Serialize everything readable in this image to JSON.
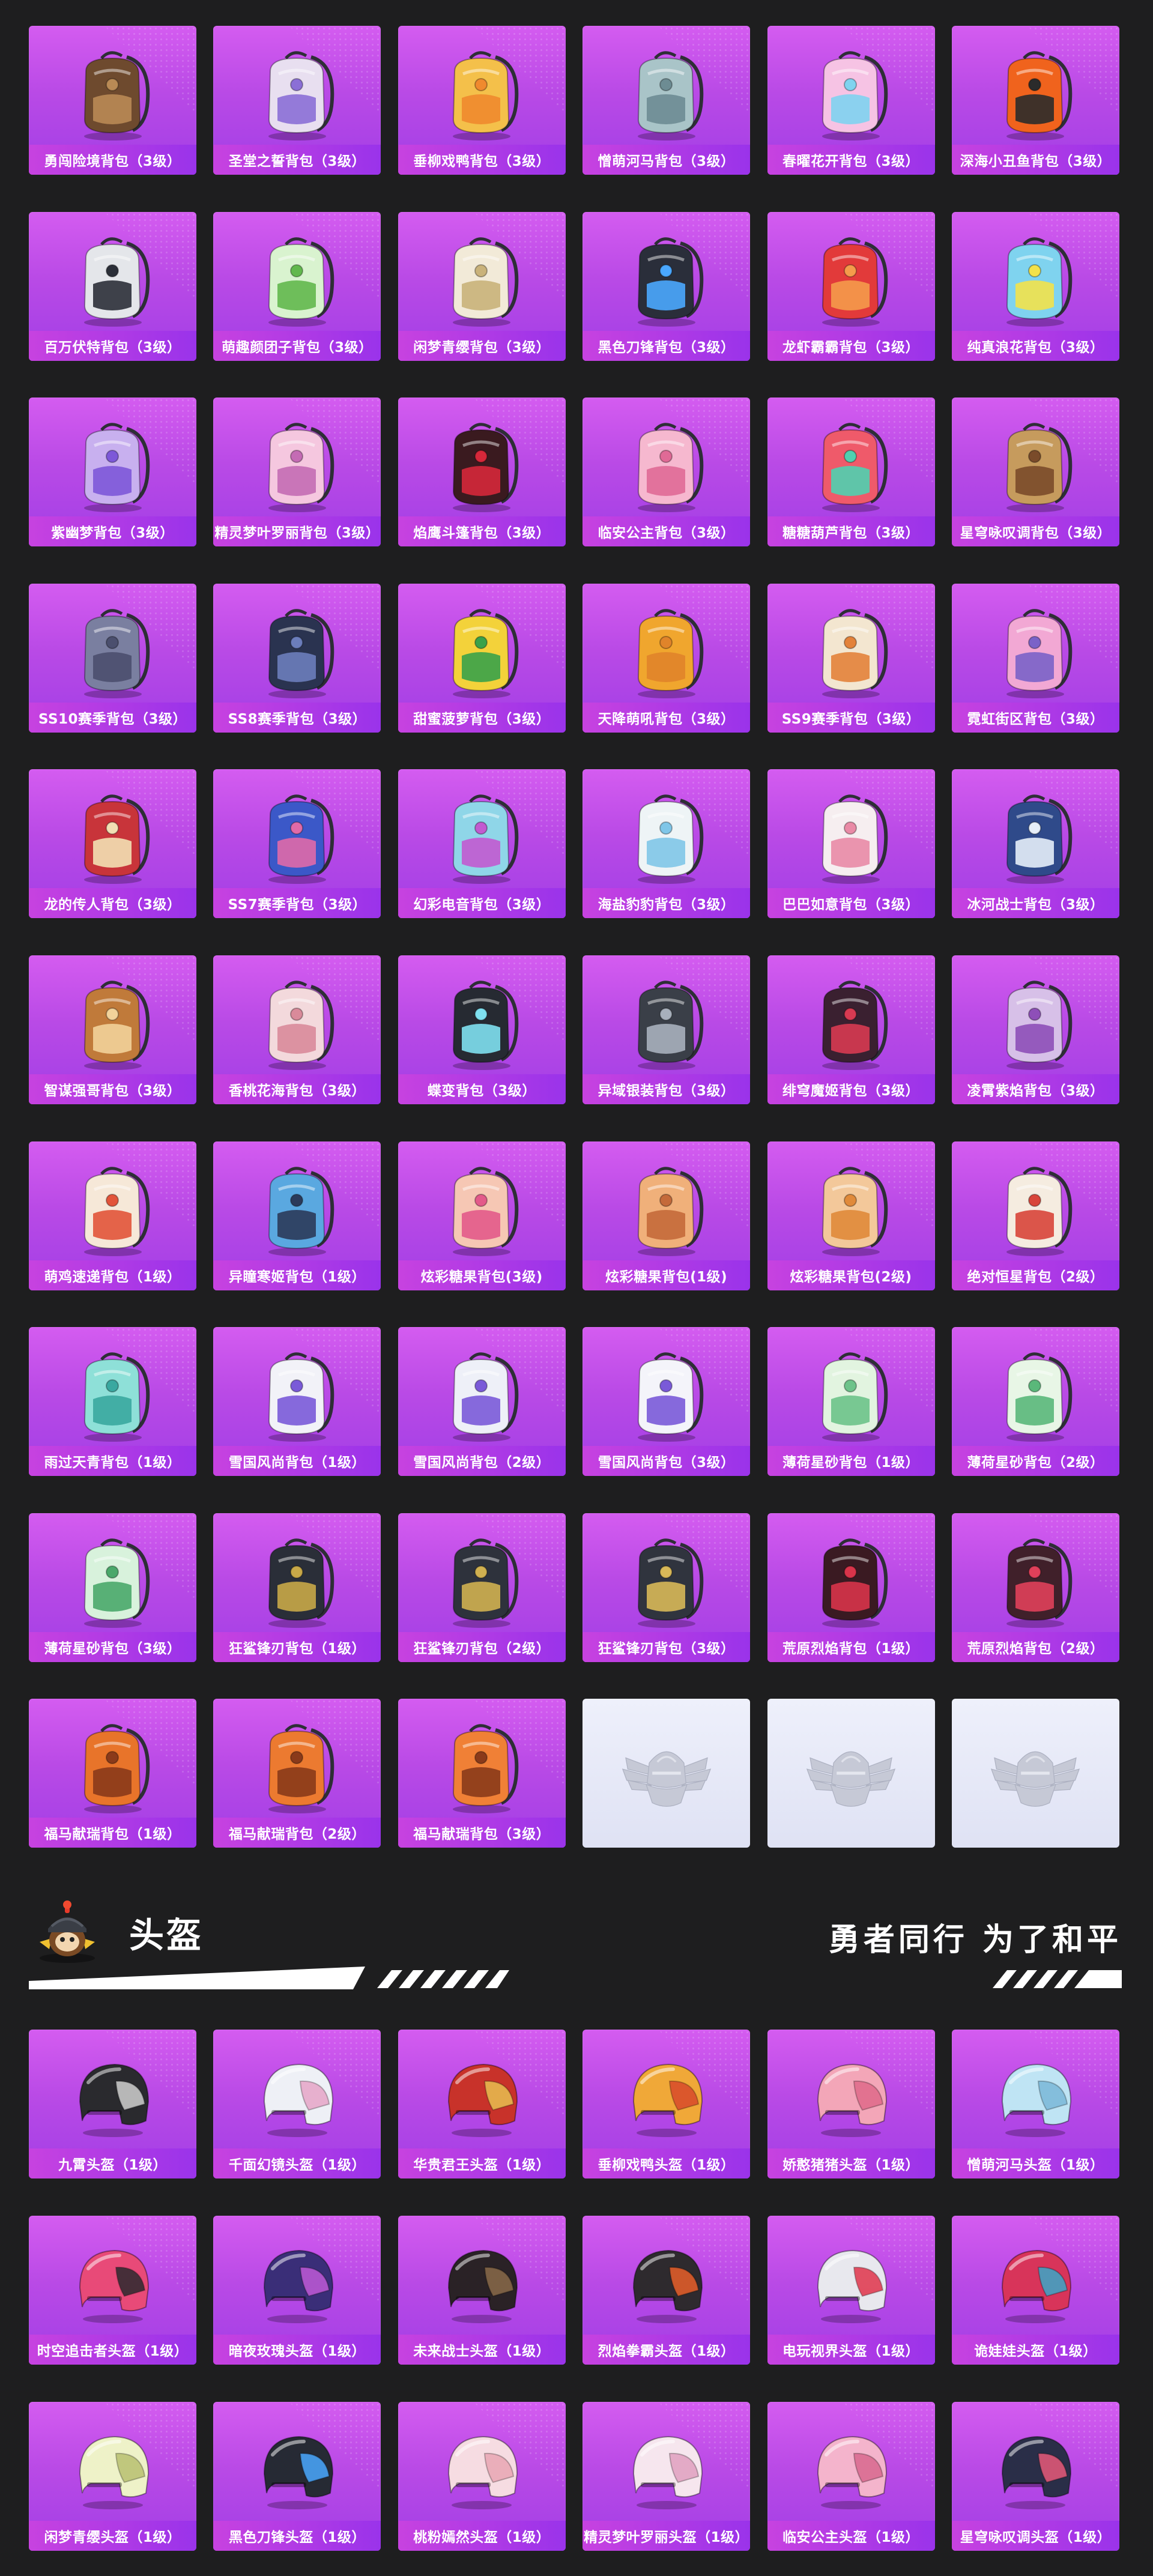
{
  "backpacks": [
    {
      "label": "勇闯险境背包（3级）",
      "icon": "brown-leather-backpack-icon",
      "color": "#6e4a2e",
      "accent": "#b98a55"
    },
    {
      "label": "圣堂之誓背包（3级）",
      "icon": "winged-white-backpack-icon",
      "color": "#e8dff0",
      "accent": "#8b6fd6"
    },
    {
      "label": "垂柳戏鸭背包（3级）",
      "icon": "yellow-duck-backpack-icon",
      "color": "#f4c04a",
      "accent": "#f08a2e"
    },
    {
      "label": "憎萌河马背包（3级）",
      "icon": "hippo-backpack-icon",
      "color": "#a9c4c8",
      "accent": "#6d8c93"
    },
    {
      "label": "春曜花开背包（3级）",
      "icon": "butterfly-backpack-icon",
      "color": "#f6c3e4",
      "accent": "#7fd3ef"
    },
    {
      "label": "深海小丑鱼背包（3级）",
      "icon": "clownfish-backpack-icon",
      "color": "#f0631d",
      "accent": "#2b2b2b"
    },
    {
      "label": "百万伏特背包（3级）",
      "icon": "robot-backpack-icon",
      "color": "#e4e6ea",
      "accent": "#2b2f38"
    },
    {
      "label": "萌趣颜团子背包（3级）",
      "icon": "green-sprout-backpack-icon",
      "color": "#d9f3cf",
      "accent": "#62b84d"
    },
    {
      "label": "闲梦青缨背包（3级）",
      "icon": "white-lantern-backpack-icon",
      "color": "#f2ead8",
      "accent": "#c9b27a"
    },
    {
      "label": "黑色刀锋背包（3级）",
      "icon": "black-tech-backpack-icon",
      "color": "#2a2e3a",
      "accent": "#4aa8ff"
    },
    {
      "label": "龙虾霸霸背包（3级）",
      "icon": "lobster-backpack-icon",
      "color": "#e23a3a",
      "accent": "#f59b4b"
    },
    {
      "label": "纯真浪花背包（3级）",
      "icon": "drink-cup-backpack-icon",
      "color": "#7fd3ef",
      "accent": "#f3e24a"
    },
    {
      "label": "紫幽梦背包（3级）",
      "icon": "purple-rabbit-backpack-icon",
      "color": "#c8b0ef",
      "accent": "#7d58d8"
    },
    {
      "label": "精灵梦叶罗丽背包（3级）",
      "icon": "pink-fairy-backpack-icon",
      "color": "#f5c7df",
      "accent": "#c46bb4"
    },
    {
      "label": "焰鹰斗篷背包（3级）",
      "icon": "red-black-backpack-icon",
      "color": "#3a1a1f",
      "accent": "#d6283a"
    },
    {
      "label": "临安公主背包（3级）",
      "icon": "pink-flower-backpack-icon",
      "color": "#f6b8cf",
      "accent": "#e06a96"
    },
    {
      "label": "糖糖葫芦背包（3级）",
      "icon": "candy-gourd-backpack-icon",
      "color": "#ef5a6a",
      "accent": "#4fd0b0"
    },
    {
      "label": "星穹咏叹调背包（3级）",
      "icon": "gold-chest-backpack-icon",
      "color": "#c69b5d",
      "accent": "#7a4b2a"
    },
    {
      "label": "SS10赛季背包（3级）",
      "icon": "grey-purple-backpack-icon",
      "color": "#7a7fa0",
      "accent": "#4b4f6e"
    },
    {
      "label": "SS8赛季背包（3级）",
      "icon": "navy-backpack-icon",
      "color": "#2a3350",
      "accent": "#6b7dbb"
    },
    {
      "label": "甜蜜菠萝背包（3级）",
      "icon": "pineapple-backpack-icon",
      "color": "#f3d23a",
      "accent": "#3aa24a"
    },
    {
      "label": "天降萌吼背包（3级）",
      "icon": "orange-gold-backpack-icon",
      "color": "#f0a62e",
      "accent": "#e0842a"
    },
    {
      "label": "SS9赛季背包（3级）",
      "icon": "orange-white-backpack-icon",
      "color": "#f3e6d0",
      "accent": "#e3823a"
    },
    {
      "label": "霓虹街区背包（3级）",
      "icon": "neon-pink-backpack-icon",
      "color": "#f2a8d4",
      "accent": "#7a62c8"
    },
    {
      "label": "龙的传人背包（3级）",
      "icon": "red-dragon-backpack-icon",
      "color": "#c8343a",
      "accent": "#f2e0b4"
    },
    {
      "label": "SS7赛季背包（3级）",
      "icon": "blue-galaxy-backpack-icon",
      "color": "#3b58c8",
      "accent": "#e06aa8"
    },
    {
      "label": "幻彩电音背包（3级）",
      "icon": "speaker-backpack-icon",
      "color": "#8fd6e8",
      "accent": "#c25ad0"
    },
    {
      "label": "海盐豹豹背包（3级）",
      "icon": "seal-backpack-icon",
      "color": "#eef4f6",
      "accent": "#7fc6e8"
    },
    {
      "label": "巴巴如意背包（3级）",
      "icon": "white-cat-backpack-icon",
      "color": "#f6eef0",
      "accent": "#e98aa6"
    },
    {
      "label": "冰河战士背包（3级）",
      "icon": "ice-blue-backpack-icon",
      "color": "#2f4a8a",
      "accent": "#e6eef8"
    },
    {
      "label": "智谋强哥背包（3级）",
      "icon": "monkey-backpack-icon",
      "color": "#c07a3a",
      "accent": "#f2d29a"
    },
    {
      "label": "香桃花海背包（3级）",
      "icon": "shell-backpack-icon",
      "color": "#f3d9dc",
      "accent": "#d98a9a"
    },
    {
      "label": "蝶变背包（3级）",
      "icon": "black-butterfly-backpack-icon",
      "color": "#262a32",
      "accent": "#7fe0f0"
    },
    {
      "label": "异域银装背包（3级）",
      "icon": "silver-armor-backpack-icon",
      "color": "#3a3f48",
      "accent": "#a8b0bc"
    },
    {
      "label": "绯穹魔姬背包（3级）",
      "icon": "bat-backpack-icon",
      "color": "#3a2030",
      "accent": "#d83a52"
    },
    {
      "label": "凌霄紫焰背包（3级）",
      "icon": "purple-flame-backpack-icon",
      "color": "#d7c0e8",
      "accent": "#8e4fb8"
    },
    {
      "label": "萌鸡速递背包（1级）",
      "icon": "chick-backpack-icon",
      "color": "#f6e8d8",
      "accent": "#e2543a"
    },
    {
      "label": "异瞳寒姬背包（1级）",
      "icon": "blue-cat-backpack-icon",
      "color": "#5aa8e0",
      "accent": "#2b3a5a"
    },
    {
      "label": "炫彩糖果背包(3级)",
      "icon": "donut-backpack-icon",
      "color": "#f6c7b4",
      "accent": "#e35a8a"
    },
    {
      "label": "炫彩糖果背包(1级)",
      "icon": "donut-backpack-icon",
      "color": "#f0b07a",
      "accent": "#c46a3a"
    },
    {
      "label": "炫彩糖果背包(2级)",
      "icon": "donut-backpack-icon",
      "color": "#f3c89a",
      "accent": "#e08a3a"
    },
    {
      "label": "绝对恒星背包（2级）",
      "icon": "noodle-box-backpack-icon",
      "color": "#f5ece0",
      "accent": "#d8453a"
    },
    {
      "label": "雨过天青背包（1级）",
      "icon": "teal-drop-backpack-icon",
      "color": "#8ee0d8",
      "accent": "#3aa8a0"
    },
    {
      "label": "雪国风尚背包（1级）",
      "icon": "snow-bunny-backpack-icon",
      "color": "#f2f2f8",
      "accent": "#7a5ad8"
    },
    {
      "label": "雪国风尚背包（2级）",
      "icon": "snow-penguin-backpack-icon",
      "color": "#eef0f8",
      "accent": "#7a5ad8"
    },
    {
      "label": "雪国风尚背包（3级）",
      "icon": "snowman-backpack-icon",
      "color": "#f4f4fa",
      "accent": "#7a5ad8"
    },
    {
      "label": "薄荷星砂背包（1级）",
      "icon": "mint-bag-backpack-icon",
      "color": "#e2f4e0",
      "accent": "#6dc38a"
    },
    {
      "label": "薄荷星砂背包（2级）",
      "icon": "mint-bag-backpack-icon",
      "color": "#e8f6e6",
      "accent": "#5ab87a"
    },
    {
      "label": "薄荷星砂背包（3级）",
      "icon": "mint-bag-backpack-icon",
      "color": "#d8f2dc",
      "accent": "#4aa86a"
    },
    {
      "label": "狂鲨锋刃背包（1级）",
      "icon": "shark-backpack-icon",
      "color": "#2a2e38",
      "accent": "#c8a848"
    },
    {
      "label": "狂鲨锋刃背包（2级）",
      "icon": "shark-backpack-icon",
      "color": "#2e323c",
      "accent": "#d0b050"
    },
    {
      "label": "狂鲨锋刃背包（3级）",
      "icon": "shark-backpack-icon",
      "color": "#30343e",
      "accent": "#d8b858"
    },
    {
      "label": "荒原烈焰背包（1级）",
      "icon": "red-fox-backpack-icon",
      "color": "#3a1a22",
      "accent": "#d8344a"
    },
    {
      "label": "荒原烈焰背包（2级）",
      "icon": "red-fox-backpack-icon",
      "color": "#40202a",
      "accent": "#e0405a"
    },
    {
      "label": "福马献瑞背包（1级）",
      "icon": "orange-rabbit-backpack-icon",
      "color": "#e8742a",
      "accent": "#8a3a1a"
    },
    {
      "label": "福马献瑞背包（2级）",
      "icon": "orange-rabbit-backpack-icon",
      "color": "#ec7a30",
      "accent": "#8a3a1a"
    },
    {
      "label": "福马献瑞背包（3级）",
      "icon": "orange-rabbit-backpack-icon",
      "color": "#f08036",
      "accent": "#8a3a1a"
    }
  ],
  "placeholders": [
    {
      "icon": "winged-helmet-emblem-icon"
    },
    {
      "icon": "winged-helmet-emblem-icon"
    },
    {
      "icon": "winged-helmet-emblem-icon"
    }
  ],
  "section": {
    "title": "头盔",
    "mascot_icon": "helmet-mascot-icon",
    "slogan": "勇者同行 为了和平"
  },
  "helmets": [
    {
      "label": "九霄头盔（1级）",
      "icon": "black-number-helmet-icon",
      "color": "#2a2a2e",
      "accent": "#d0d0d0"
    },
    {
      "label": "千面幻镜头盔（1级）",
      "icon": "cloud-art-helmet-icon",
      "color": "#eef0f6",
      "accent": "#e6a6c8"
    },
    {
      "label": "华贵君王头盔（1级）",
      "icon": "crown-helmet-icon",
      "color": "#c8322a",
      "accent": "#e8c050"
    },
    {
      "label": "垂柳戏鸭头盔（1级）",
      "icon": "orange-visor-helmet-icon",
      "color": "#f0a838",
      "accent": "#d84a2a"
    },
    {
      "label": "娇憨猪猪头盔（1级）",
      "icon": "pig-helmet-icon",
      "color": "#f3a6b8",
      "accent": "#e06a8a"
    },
    {
      "label": "憎萌河马头盔（1级）",
      "icon": "light-blue-helmet-icon",
      "color": "#bfe4f4",
      "accent": "#7ab8d8"
    },
    {
      "label": "时空追击者头盔（1级）",
      "icon": "pink-racer-helmet-icon",
      "color": "#e84a78",
      "accent": "#2a2a2e"
    },
    {
      "label": "暗夜玫瑰头盔（1级）",
      "icon": "purple-rose-helmet-icon",
      "color": "#3a2e78",
      "accent": "#c05ad8"
    },
    {
      "label": "未来战士头盔（1级）",
      "icon": "dark-warrior-helmet-icon",
      "color": "#2a2226",
      "accent": "#8a6a4a"
    },
    {
      "label": "烈焰拳霸头盔（1级）",
      "icon": "flame-helmet-icon",
      "color": "#2e2a2e",
      "accent": "#e8602a"
    },
    {
      "label": "电玩视界头盔（1级）",
      "icon": "arcade-helmet-icon",
      "color": "#e8e8ee",
      "accent": "#e0344a"
    },
    {
      "label": "诡娃娃头盔（1级）",
      "icon": "doll-helmet-icon",
      "color": "#d8345a",
      "accent": "#3aa8c8"
    },
    {
      "label": "闲梦青缨头盔（1级）",
      "icon": "cream-helmet-icon",
      "color": "#eef2c8",
      "accent": "#b8c070"
    },
    {
      "label": "黑色刀锋头盔（1级）",
      "icon": "black-blade-helmet-icon",
      "color": "#262a34",
      "accent": "#4aa8ff"
    },
    {
      "label": "桃粉嫣然头盔（1级）",
      "icon": "peach-helmet-icon",
      "color": "#f6dce2",
      "accent": "#e8a6b4"
    },
    {
      "label": "精灵梦叶罗丽头盔（1级）",
      "icon": "pearl-pink-helmet-icon",
      "color": "#f6e6ee",
      "accent": "#e0a0c0"
    },
    {
      "label": "临安公主头盔（1级）",
      "icon": "rose-pink-helmet-icon",
      "color": "#f4b4cc",
      "accent": "#d8688e"
    },
    {
      "label": "星穹咏叹调头盔（1级）",
      "icon": "starry-helmet-icon",
      "color": "#2a2e48",
      "accent": "#e85a7a"
    }
  ]
}
